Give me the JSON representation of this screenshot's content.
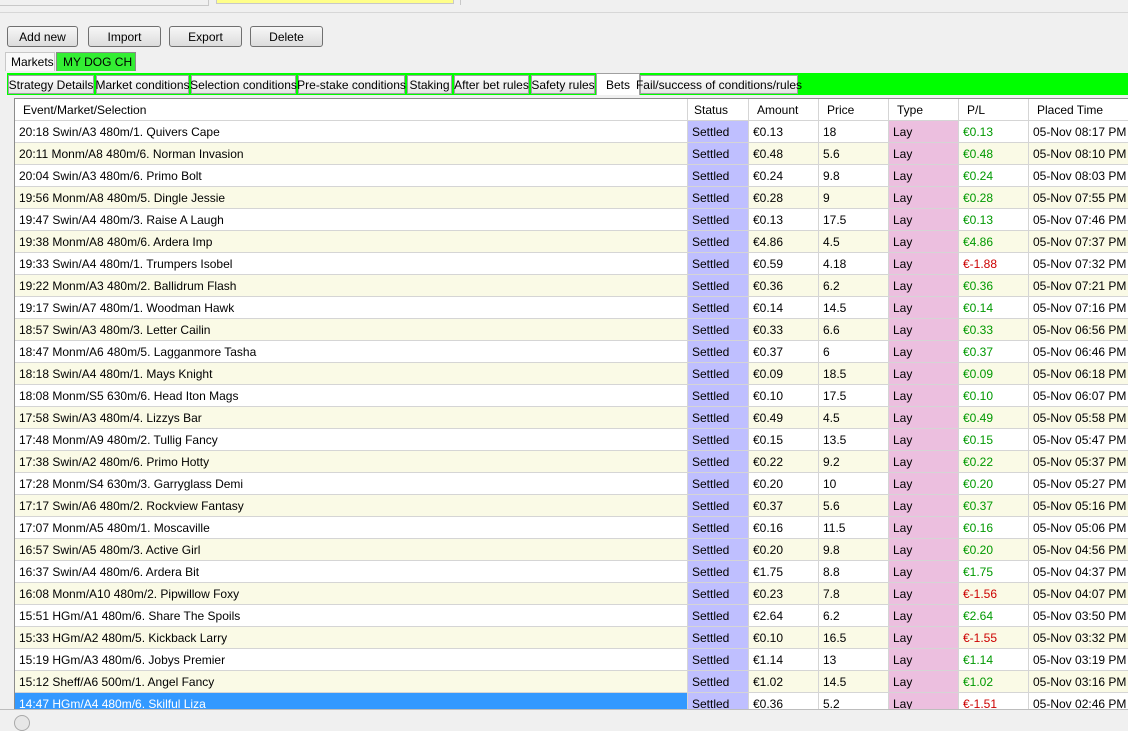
{
  "toolbar": {
    "add_new": "Add new",
    "import": "Import",
    "export": "Export",
    "delete": "Delete"
  },
  "market_tabs": [
    "Markets",
    "MY DOG CH"
  ],
  "strategy_tabs": [
    "Strategy Details",
    "Market conditions",
    "Selection conditions",
    "Pre-stake conditions",
    "Staking",
    "After bet rules",
    "Safety rules",
    "Bets",
    "Fail/success of conditions/rules"
  ],
  "active_strategy_tab": "Bets",
  "colors": {
    "tab_bar": "#00ff00",
    "status_column": "#bfbfff",
    "type_column": "#ecbfdf",
    "positive_pl": "#009900",
    "negative_pl": "#cc0000",
    "selected_row": "#3399ff"
  },
  "columns": [
    "Event/Market/Selection",
    "Status",
    "Amount",
    "Price",
    "Type",
    "P/L",
    "Placed Time"
  ],
  "bets": [
    {
      "event": "20:18 Swin/A3 480m/1. Quivers Cape",
      "status": "Settled",
      "amount": "€0.13",
      "price": "18",
      "type": "Lay",
      "pl": "€0.13",
      "time": "05-Nov 08:17 PM"
    },
    {
      "event": "20:11 Monm/A8 480m/6. Norman Invasion",
      "status": "Settled",
      "amount": "€0.48",
      "price": "5.6",
      "type": "Lay",
      "pl": "€0.48",
      "time": "05-Nov 08:10 PM"
    },
    {
      "event": "20:04 Swin/A3 480m/6. Primo Bolt",
      "status": "Settled",
      "amount": "€0.24",
      "price": "9.8",
      "type": "Lay",
      "pl": "€0.24",
      "time": "05-Nov 08:03 PM"
    },
    {
      "event": "19:56 Monm/A8 480m/5. Dingle Jessie",
      "status": "Settled",
      "amount": "€0.28",
      "price": "9",
      "type": "Lay",
      "pl": "€0.28",
      "time": "05-Nov 07:55 PM"
    },
    {
      "event": "19:47 Swin/A4 480m/3. Raise A Laugh",
      "status": "Settled",
      "amount": "€0.13",
      "price": "17.5",
      "type": "Lay",
      "pl": "€0.13",
      "time": "05-Nov 07:46 PM"
    },
    {
      "event": "19:38 Monm/A8 480m/6. Ardera Imp",
      "status": "Settled",
      "amount": "€4.86",
      "price": "4.5",
      "type": "Lay",
      "pl": "€4.86",
      "time": "05-Nov 07:37 PM"
    },
    {
      "event": "19:33 Swin/A4 480m/1. Trumpers Isobel",
      "status": "Settled",
      "amount": "€0.59",
      "price": "4.18",
      "type": "Lay",
      "pl": "€-1.88",
      "time": "05-Nov 07:32 PM"
    },
    {
      "event": "19:22 Monm/A3 480m/2. Ballidrum Flash",
      "status": "Settled",
      "amount": "€0.36",
      "price": "6.2",
      "type": "Lay",
      "pl": "€0.36",
      "time": "05-Nov 07:21 PM"
    },
    {
      "event": "19:17 Swin/A7 480m/1. Woodman Hawk",
      "status": "Settled",
      "amount": "€0.14",
      "price": "14.5",
      "type": "Lay",
      "pl": "€0.14",
      "time": "05-Nov 07:16 PM"
    },
    {
      "event": "18:57 Swin/A3 480m/3. Letter Cailin",
      "status": "Settled",
      "amount": "€0.33",
      "price": "6.6",
      "type": "Lay",
      "pl": "€0.33",
      "time": "05-Nov 06:56 PM"
    },
    {
      "event": "18:47 Monm/A6 480m/5. Lagganmore Tasha",
      "status": "Settled",
      "amount": "€0.37",
      "price": "6",
      "type": "Lay",
      "pl": "€0.37",
      "time": "05-Nov 06:46 PM"
    },
    {
      "event": "18:18 Swin/A4 480m/1. Mays Knight",
      "status": "Settled",
      "amount": "€0.09",
      "price": "18.5",
      "type": "Lay",
      "pl": "€0.09",
      "time": "05-Nov 06:18 PM"
    },
    {
      "event": "18:08 Monm/S5 630m/6. Head Iton Mags",
      "status": "Settled",
      "amount": "€0.10",
      "price": "17.5",
      "type": "Lay",
      "pl": "€0.10",
      "time": "05-Nov 06:07 PM"
    },
    {
      "event": "17:58 Swin/A3 480m/4. Lizzys Bar",
      "status": "Settled",
      "amount": "€0.49",
      "price": "4.5",
      "type": "Lay",
      "pl": "€0.49",
      "time": "05-Nov 05:58 PM"
    },
    {
      "event": "17:48 Monm/A9 480m/2. Tullig Fancy",
      "status": "Settled",
      "amount": "€0.15",
      "price": "13.5",
      "type": "Lay",
      "pl": "€0.15",
      "time": "05-Nov 05:47 PM"
    },
    {
      "event": "17:38 Swin/A2 480m/6. Primo Hotty",
      "status": "Settled",
      "amount": "€0.22",
      "price": "9.2",
      "type": "Lay",
      "pl": "€0.22",
      "time": "05-Nov 05:37 PM"
    },
    {
      "event": "17:28 Monm/S4 630m/3. Garryglass Demi",
      "status": "Settled",
      "amount": "€0.20",
      "price": "10",
      "type": "Lay",
      "pl": "€0.20",
      "time": "05-Nov 05:27 PM"
    },
    {
      "event": "17:17 Swin/A6 480m/2. Rockview Fantasy",
      "status": "Settled",
      "amount": "€0.37",
      "price": "5.6",
      "type": "Lay",
      "pl": "€0.37",
      "time": "05-Nov 05:16 PM"
    },
    {
      "event": "17:07 Monm/A5 480m/1. Moscaville",
      "status": "Settled",
      "amount": "€0.16",
      "price": "11.5",
      "type": "Lay",
      "pl": "€0.16",
      "time": "05-Nov 05:06 PM"
    },
    {
      "event": "16:57 Swin/A5 480m/3. Active Girl",
      "status": "Settled",
      "amount": "€0.20",
      "price": "9.8",
      "type": "Lay",
      "pl": "€0.20",
      "time": "05-Nov 04:56 PM"
    },
    {
      "event": "16:37 Swin/A4 480m/6. Ardera Bit",
      "status": "Settled",
      "amount": "€1.75",
      "price": "8.8",
      "type": "Lay",
      "pl": "€1.75",
      "time": "05-Nov 04:37 PM"
    },
    {
      "event": "16:08 Monm/A10 480m/2. Pipwillow Foxy",
      "status": "Settled",
      "amount": "€0.23",
      "price": "7.8",
      "type": "Lay",
      "pl": "€-1.56",
      "time": "05-Nov 04:07 PM"
    },
    {
      "event": "15:51 HGm/A1 480m/6. Share The Spoils",
      "status": "Settled",
      "amount": "€2.64",
      "price": "6.2",
      "type": "Lay",
      "pl": "€2.64",
      "time": "05-Nov 03:50 PM"
    },
    {
      "event": "15:33 HGm/A2 480m/5. Kickback Larry",
      "status": "Settled",
      "amount": "€0.10",
      "price": "16.5",
      "type": "Lay",
      "pl": "€-1.55",
      "time": "05-Nov 03:32 PM"
    },
    {
      "event": "15:19 HGm/A3 480m/6. Jobys Premier",
      "status": "Settled",
      "amount": "€1.14",
      "price": "13",
      "type": "Lay",
      "pl": "€1.14",
      "time": "05-Nov 03:19 PM"
    },
    {
      "event": "15:12 Sheff/A6 500m/1. Angel Fancy",
      "status": "Settled",
      "amount": "€1.02",
      "price": "14.5",
      "type": "Lay",
      "pl": "€1.02",
      "time": "05-Nov 03:16 PM"
    },
    {
      "event": "14:47 HGm/A4 480m/6. Skilful Liza",
      "status": "Settled",
      "amount": "€0.36",
      "price": "5.2",
      "type": "Lay",
      "pl": "€-1.51",
      "time": "05-Nov 02:46 PM"
    }
  ],
  "selected_row_index": 26
}
